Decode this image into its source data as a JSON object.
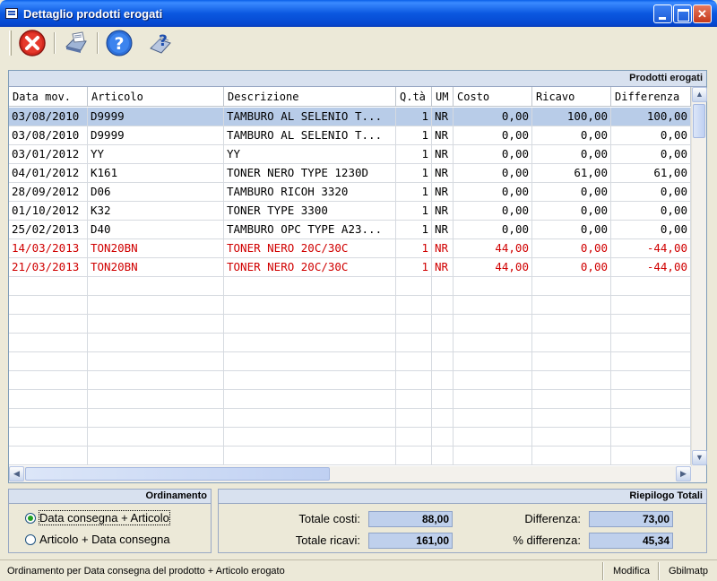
{
  "window": {
    "title": "Dettaglio prodotti erogati"
  },
  "toolbar": {
    "buttons": [
      {
        "name": "close-red-icon"
      },
      {
        "name": "print-icon"
      },
      {
        "name": "help-icon"
      },
      {
        "name": "help-document-icon"
      }
    ]
  },
  "grid": {
    "title": "Prodotti erogati",
    "columns": [
      "Data mov.",
      "Articolo",
      "Descrizione",
      "Q.tà",
      "UM",
      "Costo",
      "Ricavo",
      "Differenza"
    ],
    "rows": [
      {
        "data": "03/08/2010",
        "articolo": "D9999",
        "descrizione": "TAMBURO AL SELENIO T...",
        "qta": "1",
        "um": "NR",
        "costo": "0,00",
        "ricavo": "100,00",
        "differenza": "100,00",
        "selected": true,
        "red": false
      },
      {
        "data": "03/08/2010",
        "articolo": "D9999",
        "descrizione": "TAMBURO AL SELENIO T...",
        "qta": "1",
        "um": "NR",
        "costo": "0,00",
        "ricavo": "0,00",
        "differenza": "0,00",
        "selected": false,
        "red": false
      },
      {
        "data": "03/01/2012",
        "articolo": "YY",
        "descrizione": "YY",
        "qta": "1",
        "um": "NR",
        "costo": "0,00",
        "ricavo": "0,00",
        "differenza": "0,00",
        "selected": false,
        "red": false
      },
      {
        "data": "04/01/2012",
        "articolo": "K161",
        "descrizione": "TONER NERO TYPE 1230D",
        "qta": "1",
        "um": "NR",
        "costo": "0,00",
        "ricavo": "61,00",
        "differenza": "61,00",
        "selected": false,
        "red": false
      },
      {
        "data": "28/09/2012",
        "articolo": "D06",
        "descrizione": "TAMBURO RICOH 3320",
        "qta": "1",
        "um": "NR",
        "costo": "0,00",
        "ricavo": "0,00",
        "differenza": "0,00",
        "selected": false,
        "red": false
      },
      {
        "data": "01/10/2012",
        "articolo": "K32",
        "descrizione": "TONER TYPE 3300",
        "qta": "1",
        "um": "NR",
        "costo": "0,00",
        "ricavo": "0,00",
        "differenza": "0,00",
        "selected": false,
        "red": false
      },
      {
        "data": "25/02/2013",
        "articolo": "D40",
        "descrizione": "TAMBURO OPC TYPE A23...",
        "qta": "1",
        "um": "NR",
        "costo": "0,00",
        "ricavo": "0,00",
        "differenza": "0,00",
        "selected": false,
        "red": false
      },
      {
        "data": "14/03/2013",
        "articolo": "TON20BN",
        "descrizione": "TONER NERO 20C/30C",
        "qta": "1",
        "um": "NR",
        "costo": "44,00",
        "ricavo": "0,00",
        "differenza": "-44,00",
        "selected": false,
        "red": true
      },
      {
        "data": "21/03/2013",
        "articolo": "TON20BN",
        "descrizione": "TONER NERO 20C/30C",
        "qta": "1",
        "um": "NR",
        "costo": "44,00",
        "ricavo": "0,00",
        "differenza": "-44,00",
        "selected": false,
        "red": true
      }
    ],
    "empty_row_count": 10
  },
  "ordinamento": {
    "title": "Ordinamento",
    "options": [
      {
        "label": "Data consegna + Articolo",
        "checked": true
      },
      {
        "label": "Articolo + Data consegna",
        "checked": false
      }
    ]
  },
  "riepilogo": {
    "title": "Riepilogo Totali",
    "totale_costi_label": "Totale costi:",
    "totale_costi": "88,00",
    "totale_ricavi_label": "Totale ricavi:",
    "totale_ricavi": "161,00",
    "differenza_label": "Differenza:",
    "differenza": "73,00",
    "perc_label": "% differenza:",
    "perc": "45,34"
  },
  "statusbar": {
    "message": "Ordinamento per Data consegna del prodotto + Articolo erogato",
    "mode": "Modifica",
    "module": "Gbilmatp"
  }
}
